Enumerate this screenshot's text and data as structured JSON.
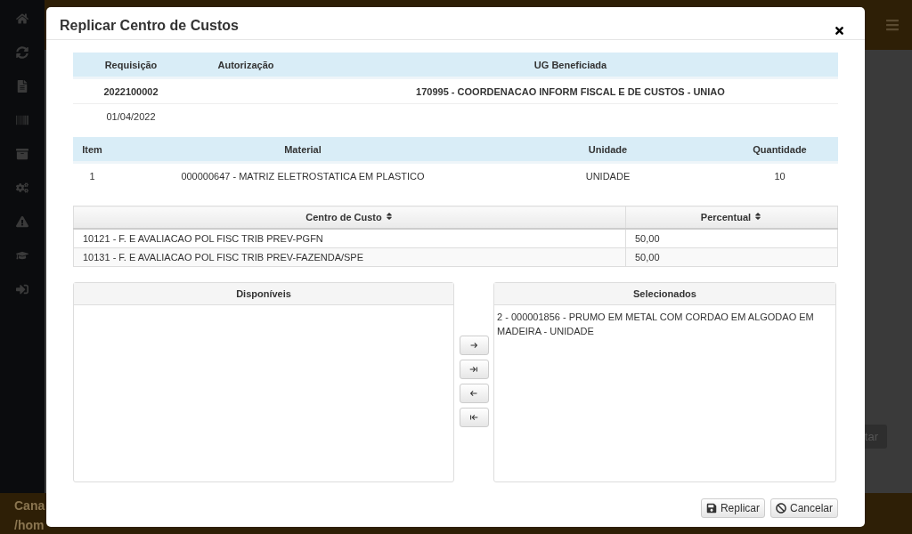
{
  "background": {
    "footer_texts": [
      "Cana",
      "/hom"
    ],
    "right_button": "tar"
  },
  "modal": {
    "title": "Replicar Centro de Custos",
    "summary": {
      "columns": [
        "Requisição",
        "Autorização",
        "UG Beneficiada"
      ],
      "rows": [
        [
          "2022100002",
          "",
          "170995 - COORDENACAO INFORM FISCAL E DE CUSTOS - UNIAO"
        ],
        [
          "01/04/2022",
          "",
          ""
        ]
      ]
    },
    "items": {
      "columns": [
        "Item",
        "Material",
        "Unidade",
        "Quantidade"
      ],
      "rows": [
        [
          "1",
          "000000647 - MATRIZ ELETROSTATICA EM PLASTICO",
          "UNIDADE",
          "10"
        ]
      ]
    },
    "cost_centers": {
      "columns": [
        "Centro de Custo",
        "Percentual"
      ],
      "rows": [
        [
          "10121 - F. E AVALIACAO POL FISC TRIB PREV-PGFN",
          "50,00"
        ],
        [
          "10131 - F. E AVALIACAO POL FISC TRIB PREV-FAZENDA/SPE",
          "50,00"
        ]
      ]
    },
    "available": {
      "title": "Disponíveis"
    },
    "selected": {
      "title": "Selecionados",
      "items": [
        "2 - 000001856 - PRUMO EM METAL COM CORDAO EM ALGODAO EM MADEIRA - UNIDADE"
      ]
    },
    "move_buttons": [
      {
        "kind": "right"
      },
      {
        "kind": "all-right"
      },
      {
        "kind": "left"
      },
      {
        "kind": "all-left"
      }
    ],
    "buttons": [
      {
        "kind": "save",
        "label": "Replicar"
      },
      {
        "kind": "cancel",
        "label": "Cancelar"
      }
    ]
  }
}
